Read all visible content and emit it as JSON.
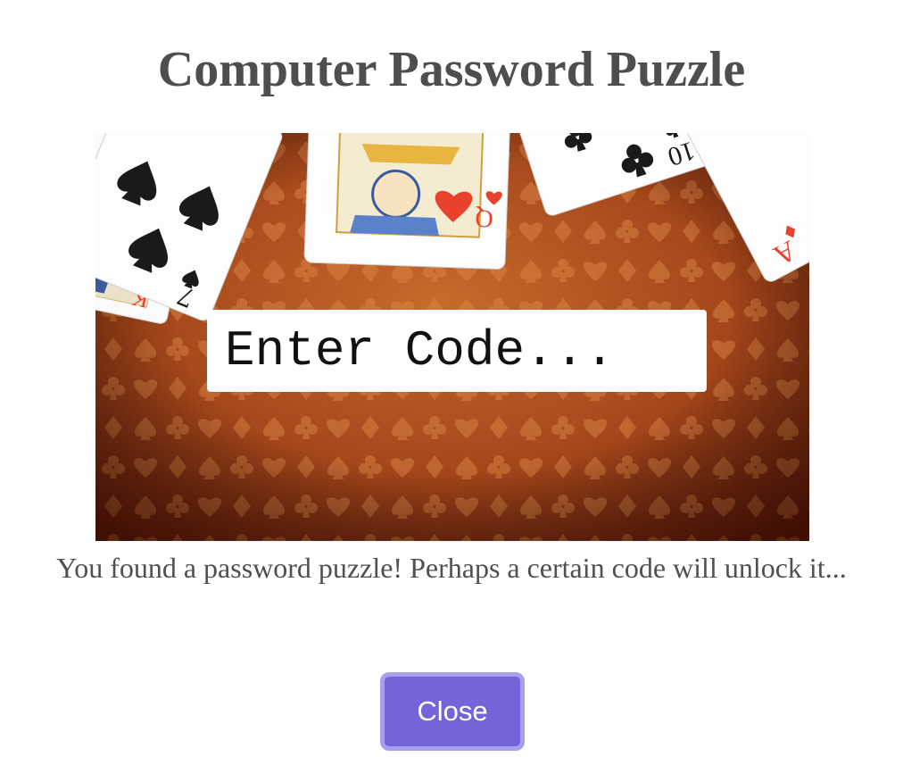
{
  "dialog": {
    "title": "Computer Password Puzzle",
    "description": "You found a password puzzle! Perhaps a certain code will unlock it...",
    "close_label": "Close"
  },
  "image": {
    "code_prompt": "Enter Code...",
    "card_labels": {
      "king_index": "K",
      "seven_index": "7",
      "queen_index": "Q",
      "ten_index": "10",
      "ace_index": "A"
    }
  },
  "colors": {
    "accent": "#7264d9",
    "accent_border": "#a8a0ee",
    "heading": "#4e4e4e",
    "body_text": "#505050",
    "felt_center": "#c4652a",
    "felt_edge": "#5a1808",
    "card_red": "#e8412c"
  }
}
